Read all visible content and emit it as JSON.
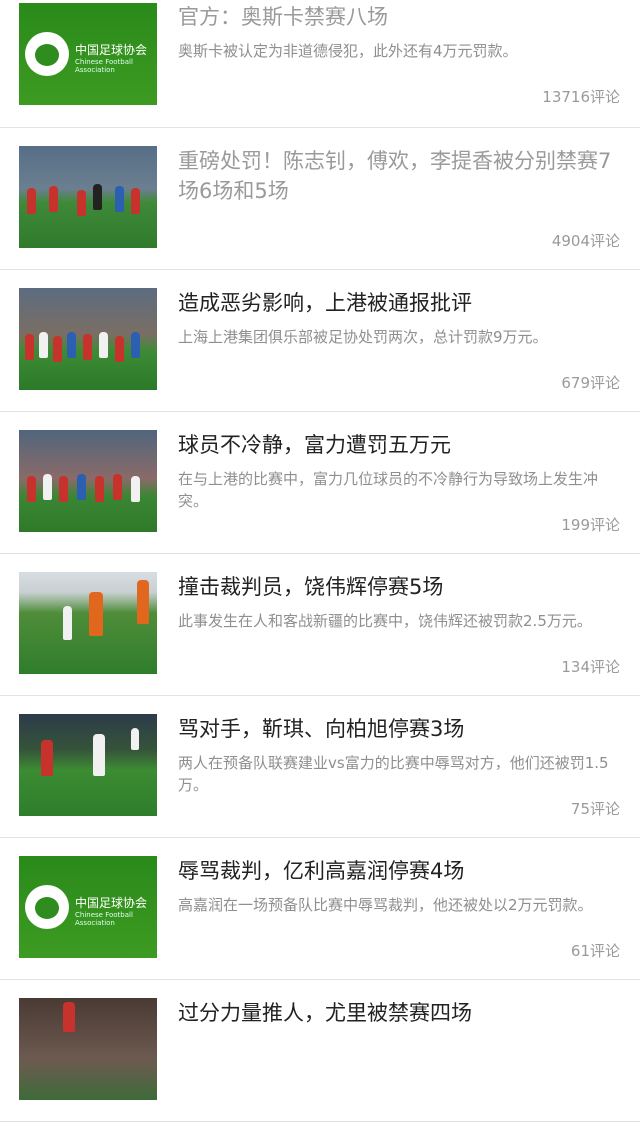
{
  "items": [
    {
      "thumb": "cfa",
      "thumb_text_cn": "中国足球协会",
      "thumb_text_en": "Chinese Football Association",
      "title": "官方：奥斯卡禁赛八场",
      "summary": "奥斯卡被认定为非道德侵犯，此外还有4万元罚款。",
      "comments": "13716评论",
      "read": true
    },
    {
      "thumb": "photo",
      "title": "重磅处罚！陈志钊，傅欢，李提香被分别禁赛7场6场和5场",
      "summary": "",
      "comments": "4904评论",
      "read": true
    },
    {
      "thumb": "photo",
      "title": "造成恶劣影响，上港被通报批评",
      "summary": "上海上港集团俱乐部被足协处罚两次，总计罚款9万元。",
      "comments": "679评论",
      "read": false
    },
    {
      "thumb": "photo",
      "title": "球员不冷静，富力遭罚五万元",
      "summary": "在与上港的比赛中，富力几位球员的不冷静行为导致场上发生冲突。",
      "comments": "199评论",
      "read": false
    },
    {
      "thumb": "photo",
      "title": "撞击裁判员，饶伟辉停赛5场",
      "summary": "此事发生在人和客战新疆的比赛中，饶伟辉还被罚款2.5万元。",
      "comments": "134评论",
      "read": false
    },
    {
      "thumb": "photo",
      "title": "骂对手，靳琪、向柏旭停赛3场",
      "summary": "两人在预备队联赛建业vs富力的比赛中辱骂对方，他们还被罚1.5万。",
      "comments": "75评论",
      "read": false
    },
    {
      "thumb": "cfa",
      "thumb_text_cn": "中国足球协会",
      "thumb_text_en": "Chinese Football Association",
      "title": "辱骂裁判，亿利高嘉润停赛4场",
      "summary": "高嘉润在一场预备队比赛中辱骂裁判，他还被处以2万元罚款。",
      "comments": "61评论",
      "read": false
    },
    {
      "thumb": "photo",
      "title": "过分力量推人，尤里被禁赛四场",
      "summary": "",
      "comments": "",
      "read": false
    }
  ]
}
